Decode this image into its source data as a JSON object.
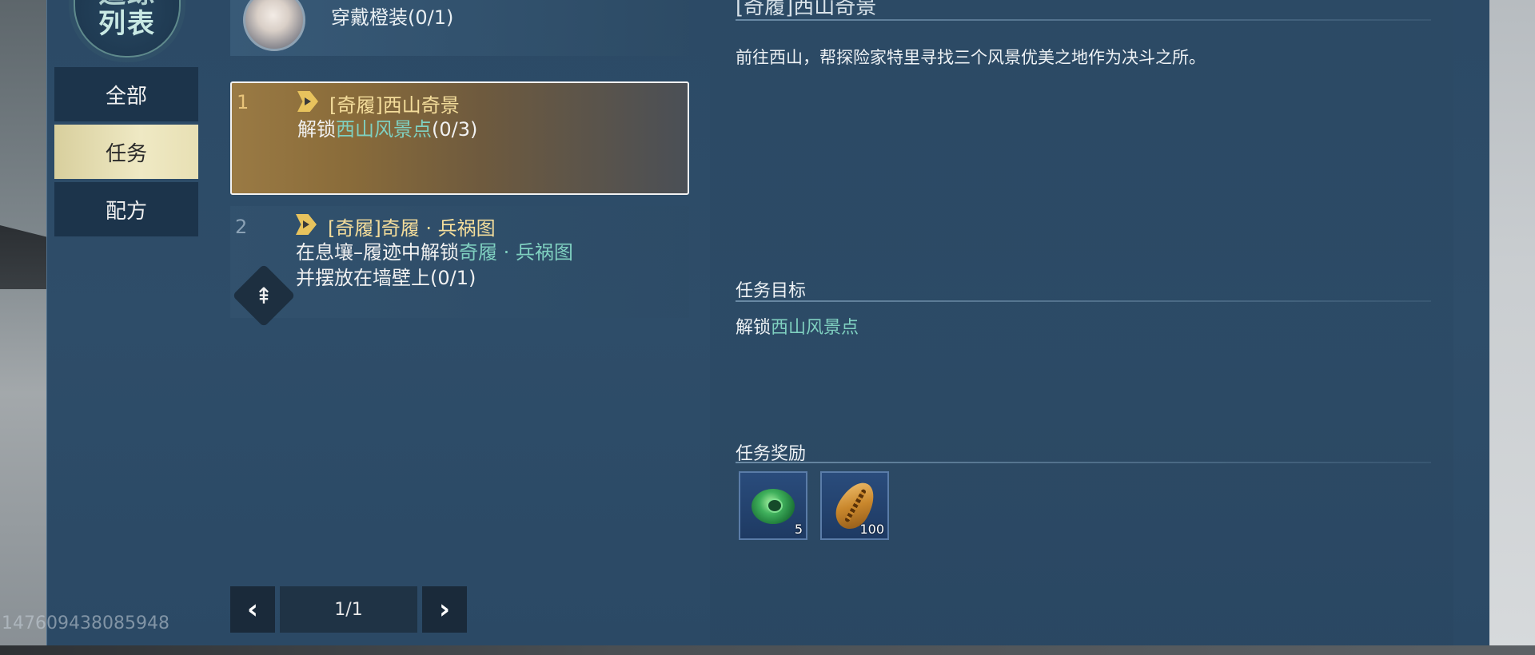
{
  "header": {
    "emblem_top": "追踪",
    "emblem_bottom": "列表",
    "avatar_task": "穿戴橙装(0/1)"
  },
  "sidebar": {
    "items": [
      {
        "label": "全部",
        "active": false
      },
      {
        "label": "任务",
        "active": true
      },
      {
        "label": "配方",
        "active": false
      }
    ]
  },
  "quests": [
    {
      "number": "1",
      "title": "[奇履]西山奇景",
      "desc_prefix": "解锁",
      "desc_highlight": "西山风景点",
      "desc_suffix": "(0/3)",
      "selected": true
    },
    {
      "number": "2",
      "title": "[奇履]奇履 · 兵祸图",
      "desc_prefix": "在息壤–履迹中解锁",
      "desc_highlight": "奇履 · 兵祸图",
      "desc_line2": "并摆放在墙壁上(0/1)",
      "selected": false
    }
  ],
  "pager": {
    "text": "1/1",
    "prev_icon": "chevron-left-icon",
    "next_icon": "chevron-right-icon"
  },
  "detail": {
    "title": "[奇履]西山奇景",
    "description": "前往西山，帮探险家特里寻找三个风景优美之地作为决斗之所。",
    "goal_label": "任务目标",
    "goal_prefix": "解锁",
    "goal_highlight": "西山风景点",
    "reward_label": "任务奖励",
    "rewards": [
      {
        "icon": "jade-icon",
        "count": "5"
      },
      {
        "icon": "shell-coin-icon",
        "count": "100"
      }
    ]
  },
  "watermark": "147609438085948",
  "colors": {
    "panel": "#2c4a66",
    "highlight_text": "#7fd0c0",
    "quest_title": "#f4dd9b",
    "active_tab": "#efe9c4"
  }
}
